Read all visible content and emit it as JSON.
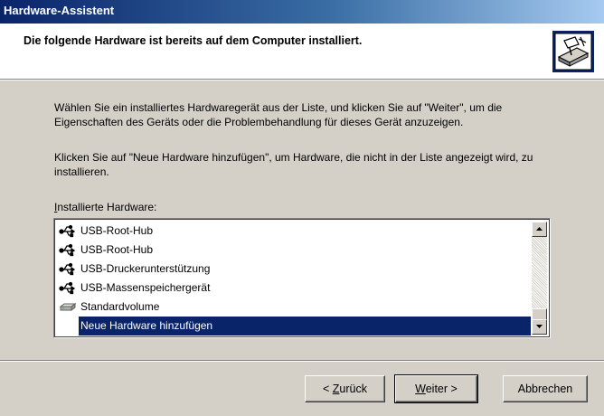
{
  "window": {
    "title": "Hardware-Assistent"
  },
  "header": {
    "title": "Die folgende Hardware ist bereits auf dem Computer installiert."
  },
  "body": {
    "paragraph1": "Wählen Sie ein installiertes Hardwaregerät aus der Liste, und klicken Sie auf \"Weiter\", um die Eigenschaften des Geräts oder die Problembehandlung für dieses Gerät anzuzeigen.",
    "paragraph2": "Klicken Sie auf \"Neue Hardware hinzufügen\", um Hardware, die nicht in der Liste angezeigt wird, zu installieren.",
    "list_label_accel": "I",
    "list_label_rest": "nstallierte Hardware:"
  },
  "hardware_list": {
    "items": [
      {
        "label": "USB-Root-Hub",
        "icon": "usb-icon",
        "selected": false
      },
      {
        "label": "USB-Root-Hub",
        "icon": "usb-icon",
        "selected": false
      },
      {
        "label": "USB-Druckerunterstützung",
        "icon": "usb-icon",
        "selected": false
      },
      {
        "label": "USB-Massenspeichergerät",
        "icon": "usb-icon",
        "selected": false
      },
      {
        "label": "Standardvolume",
        "icon": "drive-icon",
        "selected": false
      },
      {
        "label": "Neue Hardware hinzufügen",
        "icon": "",
        "selected": true
      }
    ]
  },
  "buttons": {
    "back": {
      "prefix": "< ",
      "accel": "Z",
      "rest": "urück"
    },
    "next": {
      "accel": "W",
      "rest": "eiter",
      "suffix": " >"
    },
    "cancel": "Abbrechen"
  },
  "colors": {
    "selection": "#0a246a",
    "face": "#d4d0c8",
    "title_start": "#0a246a",
    "title_end": "#a6caf0"
  }
}
